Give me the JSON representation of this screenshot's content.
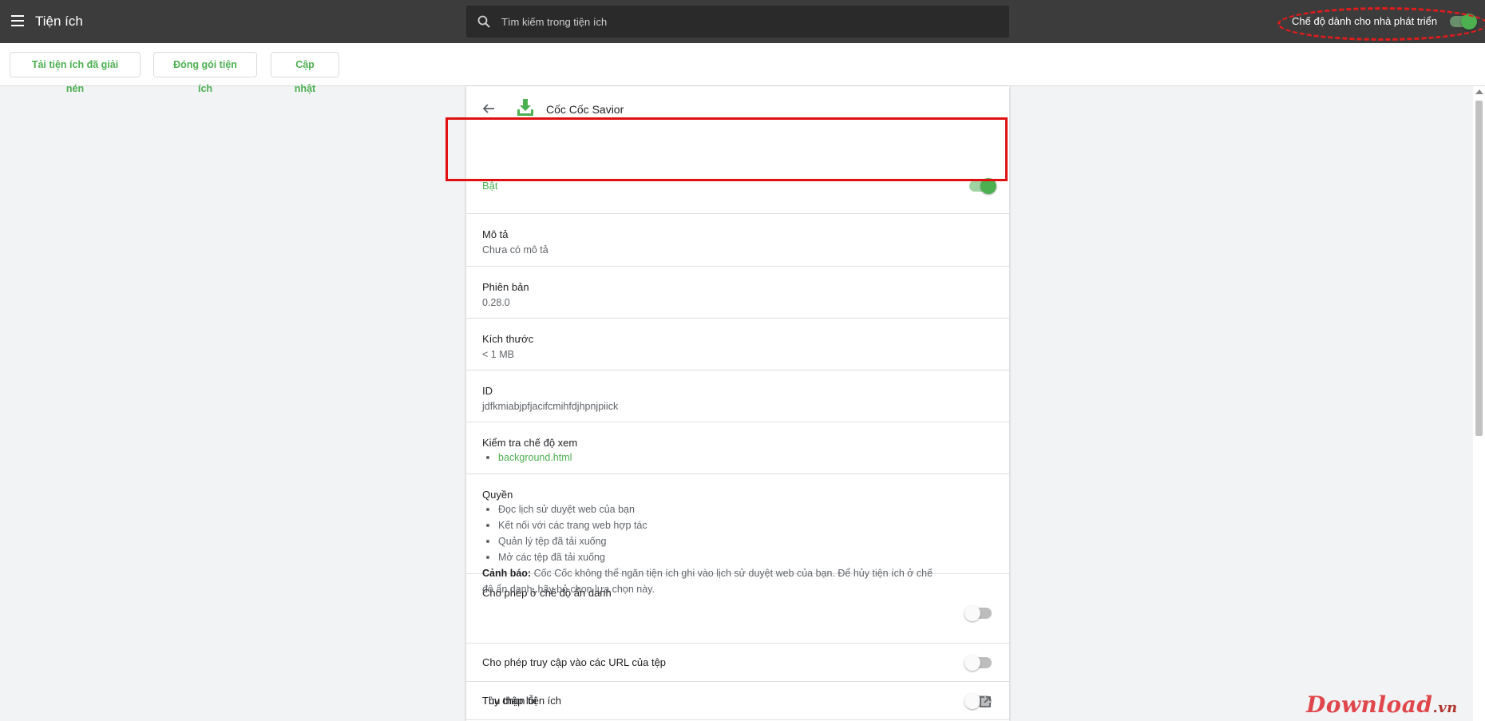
{
  "header": {
    "title": "Tiện ích",
    "search_placeholder": "Tìm kiếm trong tiện ích",
    "developer_mode_label": "Chế độ dành cho nhà phát triển",
    "developer_mode_on": true
  },
  "toolbar": {
    "load_unpacked": "Tải tiện ích đã giải nén",
    "pack_extension": "Đóng gói tiện ích",
    "update": "Cập nhật"
  },
  "extension": {
    "name": "Cốc Cốc Savior",
    "enabled_label": "Bật",
    "enabled": true,
    "description_label": "Mô tả",
    "description_value": "Chưa có mô tả",
    "version_label": "Phiên bản",
    "version_value": "0.28.0",
    "size_label": "Kích thước",
    "size_value": "< 1 MB",
    "id_label": "ID",
    "id_value": "jdfkmiabjpfjacifcmihfdjhpnjpiick",
    "inspect_label": "Kiểm tra chế độ xem",
    "inspect_views": [
      "background.html"
    ],
    "permissions_label": "Quyền",
    "permissions": [
      "Đọc lịch sử duyệt web của bạn",
      "Kết nối với các trang web hợp tác",
      "Quản lý tệp đã tải xuống",
      "Mở các tệp đã tải xuống"
    ],
    "incognito_label": "Cho phép ở chế độ ẩn danh",
    "incognito_warning_bold": "Cảnh báo:",
    "incognito_warning_text": " Cốc Cốc không thể ngăn tiện ích ghi vào lịch sử duyệt web của bạn. Để hủy tiện ích ở chế độ ẩn danh, hãy bỏ chọn lựa chọn này.",
    "incognito_enabled": false,
    "file_urls_label": "Cho phép truy cập vào các URL của tệp",
    "file_urls_enabled": false,
    "collect_errors_label": "Thu thập lỗi",
    "collect_errors_enabled": false,
    "options_label": "Tùy chọn tiện ích"
  },
  "watermark": {
    "brand": "Download",
    "tld": ".vn"
  },
  "colors": {
    "accent": "#4caf50",
    "topbar": "#3c3c3c",
    "annotation": "#e01010"
  },
  "icons": [
    "menu-icon",
    "search-icon",
    "back-icon",
    "download-icon",
    "external-link-icon"
  ]
}
